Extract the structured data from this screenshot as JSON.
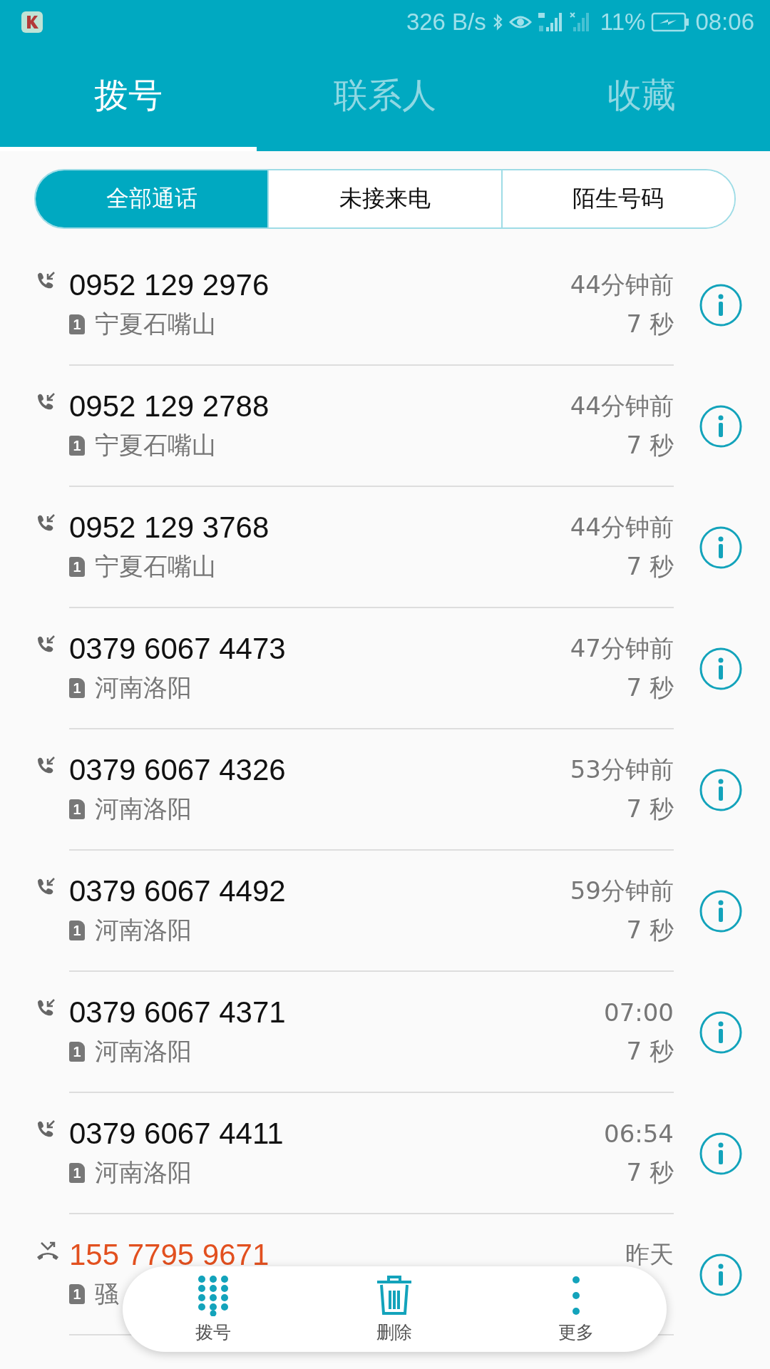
{
  "status_bar": {
    "net_speed": "326 B/s",
    "battery": "11%",
    "time": "08:06"
  },
  "tabs": [
    {
      "label": "拨号",
      "selected": true
    },
    {
      "label": "联系人",
      "selected": false
    },
    {
      "label": "收藏",
      "selected": false
    }
  ],
  "filters": [
    {
      "label": "全部通话",
      "selected": true
    },
    {
      "label": "未接来电",
      "selected": false
    },
    {
      "label": "陌生号码",
      "selected": false
    }
  ],
  "calls": [
    {
      "kind": "incoming",
      "number": "0952 129 2976",
      "sim": "1",
      "location": "宁夏石嘴山",
      "time": "44分钟前",
      "duration": "7 秒"
    },
    {
      "kind": "incoming",
      "number": "0952 129 2788",
      "sim": "1",
      "location": "宁夏石嘴山",
      "time": "44分钟前",
      "duration": "7 秒"
    },
    {
      "kind": "incoming",
      "number": "0952 129 3768",
      "sim": "1",
      "location": "宁夏石嘴山",
      "time": "44分钟前",
      "duration": "7 秒"
    },
    {
      "kind": "incoming",
      "number": "0379 6067 4473",
      "sim": "1",
      "location": "河南洛阳",
      "time": "47分钟前",
      "duration": "7 秒"
    },
    {
      "kind": "incoming",
      "number": "0379 6067 4326",
      "sim": "1",
      "location": "河南洛阳",
      "time": "53分钟前",
      "duration": "7 秒"
    },
    {
      "kind": "incoming",
      "number": "0379 6067 4492",
      "sim": "1",
      "location": "河南洛阳",
      "time": "59分钟前",
      "duration": "7 秒"
    },
    {
      "kind": "incoming",
      "number": "0379 6067 4371",
      "sim": "1",
      "location": "河南洛阳",
      "time": "07:00",
      "duration": "7 秒"
    },
    {
      "kind": "incoming",
      "number": "0379 6067 4411",
      "sim": "1",
      "location": "河南洛阳",
      "time": "06:54",
      "duration": "7 秒"
    },
    {
      "kind": "missed",
      "number": "155 7795 9671",
      "sim": "1",
      "location": "骚",
      "time": "昨天"
    }
  ],
  "bottom_actions": [
    {
      "kind": "dialpad",
      "label": "拨号"
    },
    {
      "kind": "delete",
      "label": "删除"
    },
    {
      "kind": "more",
      "label": "更多"
    }
  ]
}
